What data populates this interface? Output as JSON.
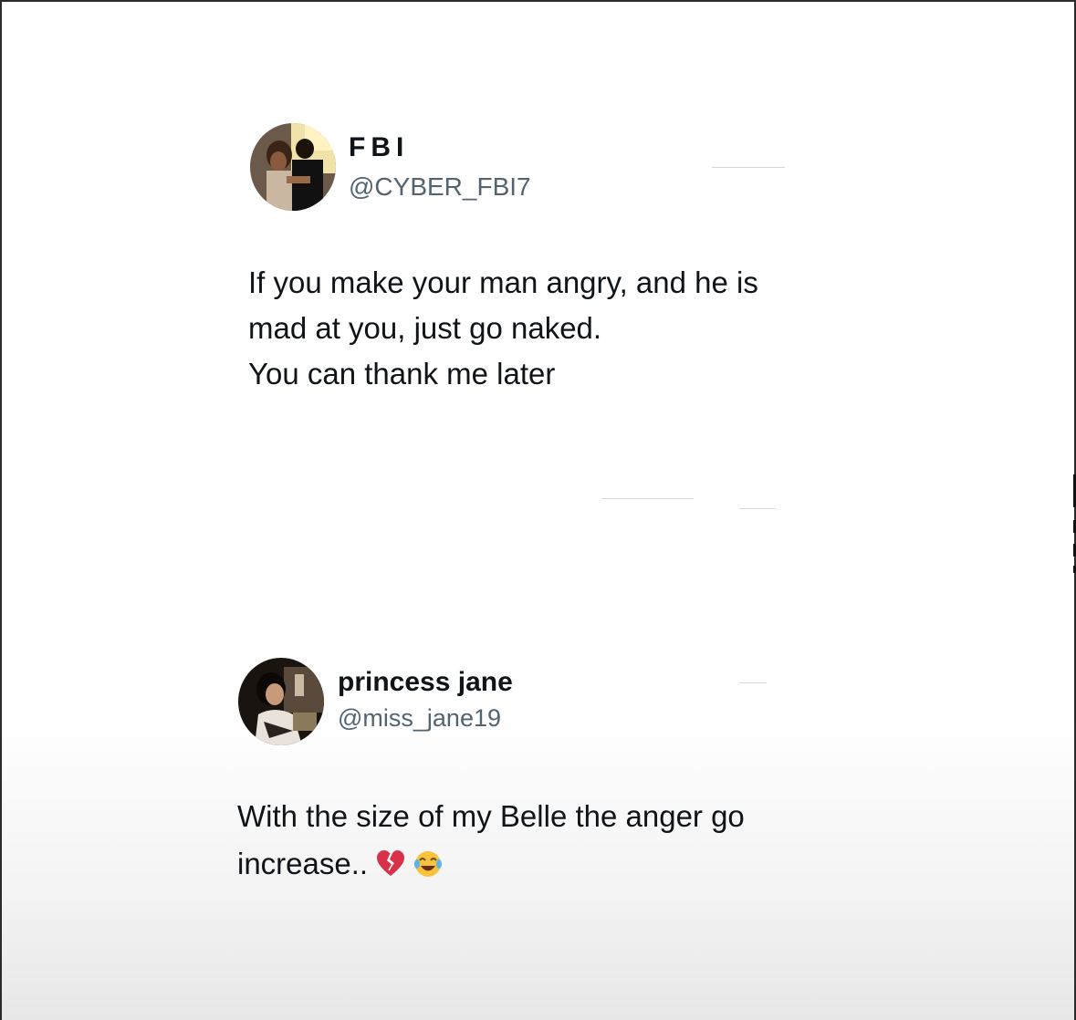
{
  "tweets": [
    {
      "display_name": "FBI",
      "handle": "@CYBER_FBI7",
      "body_lines": [
        "If you make your man angry, and he is",
        "mad at you, just go naked.",
        "You can thank me later"
      ]
    },
    {
      "display_name": "princess jane",
      "handle": "@miss_jane19",
      "body_lines": [
        "With the size of my Belle the anger go",
        "increase.."
      ],
      "emojis": [
        "broken-heart-icon",
        "crying-laughing-face-icon"
      ]
    }
  ],
  "colors": {
    "text_primary": "#0f1419",
    "text_secondary": "#536471",
    "broken_heart": "#d9314a",
    "emoji_face": "#f7c33b"
  }
}
